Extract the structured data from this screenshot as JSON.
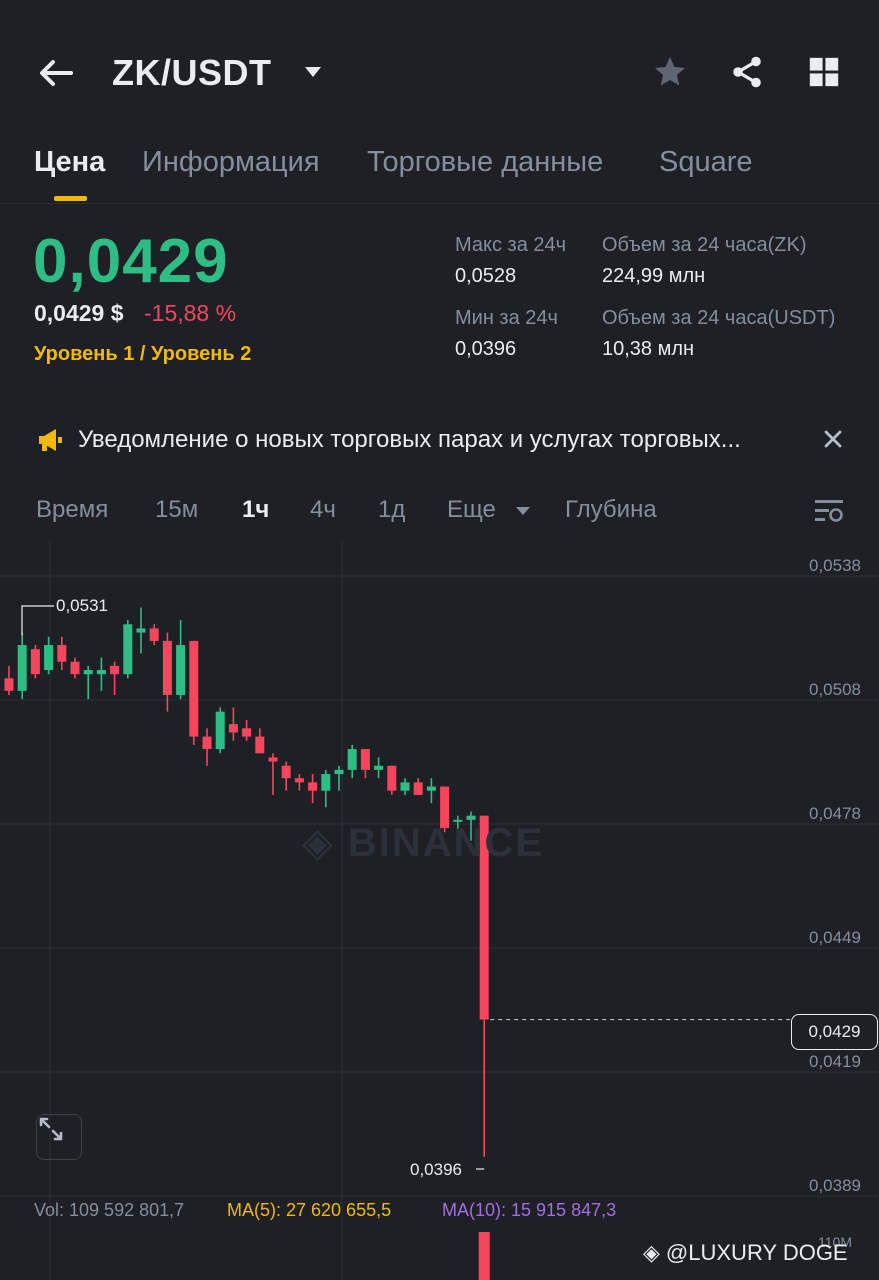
{
  "header": {
    "pair": "ZK/USDT",
    "icons": [
      "back-arrow-icon",
      "caret-down-icon",
      "star-icon",
      "share-icon",
      "grid-icon"
    ]
  },
  "tabs": [
    {
      "label": "Цена",
      "active": true
    },
    {
      "label": "Информация",
      "active": false
    },
    {
      "label": "Торговые данные",
      "active": false
    },
    {
      "label": "Square",
      "active": false
    }
  ],
  "price": {
    "last": "0,0429",
    "usd": "0,0429 $",
    "change": "-15,88 %",
    "level": "Уровень 1 / Уровень 2"
  },
  "stats": {
    "high_label": "Макс за 24ч",
    "high_value": "0,0528",
    "low_label": "Мин за 24ч",
    "low_value": "0,0396",
    "vol_base_label": "Объем за 24 часа(ZK)",
    "vol_base_value": "224,99 млн",
    "vol_quote_label": "Объем за 24 часа(USDT)",
    "vol_quote_value": "10,38 млн"
  },
  "notice": {
    "text": "Уведомление о новых торговых парах и услугах торговых...",
    "icon": "megaphone-icon"
  },
  "intervals": [
    {
      "label": "Время",
      "active": false
    },
    {
      "label": "15м",
      "active": false
    },
    {
      "label": "1ч",
      "active": true
    },
    {
      "label": "4ч",
      "active": false
    },
    {
      "label": "1д",
      "active": false
    },
    {
      "label": "Еще",
      "active": false
    },
    {
      "label": "Глубина",
      "active": false
    }
  ],
  "chart_data": {
    "type": "candlestick",
    "y_ticks": [
      "0,0538",
      "0,0508",
      "0,0478",
      "0,0449",
      "0,0419",
      "0,0389"
    ],
    "ylim": [
      0.0389,
      0.0538
    ],
    "current_price": "0,0429",
    "high_marker": "0,0531",
    "low_marker": "0,0396",
    "watermark": "BINANCE",
    "candles": [
      {
        "o": 0.0511,
        "h": 0.0514,
        "l": 0.0507,
        "c": 0.0508
      },
      {
        "o": 0.0508,
        "h": 0.0522,
        "l": 0.0506,
        "c": 0.0519
      },
      {
        "o": 0.0518,
        "h": 0.0519,
        "l": 0.0511,
        "c": 0.0512
      },
      {
        "o": 0.0513,
        "h": 0.0521,
        "l": 0.0512,
        "c": 0.0519
      },
      {
        "o": 0.0519,
        "h": 0.0521,
        "l": 0.0513,
        "c": 0.0515
      },
      {
        "o": 0.0515,
        "h": 0.0516,
        "l": 0.0511,
        "c": 0.0512
      },
      {
        "o": 0.0512,
        "h": 0.0514,
        "l": 0.0506,
        "c": 0.0513
      },
      {
        "o": 0.0512,
        "h": 0.0516,
        "l": 0.0508,
        "c": 0.0513
      },
      {
        "o": 0.0514,
        "h": 0.0515,
        "l": 0.0507,
        "c": 0.0512
      },
      {
        "o": 0.0512,
        "h": 0.0525,
        "l": 0.0511,
        "c": 0.0524
      },
      {
        "o": 0.0522,
        "h": 0.0528,
        "l": 0.0517,
        "c": 0.0523
      },
      {
        "o": 0.0523,
        "h": 0.0524,
        "l": 0.0519,
        "c": 0.052
      },
      {
        "o": 0.052,
        "h": 0.0522,
        "l": 0.0503,
        "c": 0.0507
      },
      {
        "o": 0.0507,
        "h": 0.0525,
        "l": 0.0506,
        "c": 0.0519
      },
      {
        "o": 0.052,
        "h": 0.052,
        "l": 0.0495,
        "c": 0.0497
      },
      {
        "o": 0.0497,
        "h": 0.0499,
        "l": 0.049,
        "c": 0.0494
      },
      {
        "o": 0.0494,
        "h": 0.0504,
        "l": 0.0493,
        "c": 0.0503
      },
      {
        "o": 0.05,
        "h": 0.0504,
        "l": 0.0496,
        "c": 0.0498
      },
      {
        "o": 0.0499,
        "h": 0.0501,
        "l": 0.0496,
        "c": 0.0497
      },
      {
        "o": 0.0497,
        "h": 0.0499,
        "l": 0.0493,
        "c": 0.0493
      },
      {
        "o": 0.0492,
        "h": 0.0493,
        "l": 0.0483,
        "c": 0.0491
      },
      {
        "o": 0.049,
        "h": 0.0491,
        "l": 0.0484,
        "c": 0.0487
      },
      {
        "o": 0.0487,
        "h": 0.0488,
        "l": 0.0484,
        "c": 0.0486
      },
      {
        "o": 0.0486,
        "h": 0.0488,
        "l": 0.0481,
        "c": 0.0484
      },
      {
        "o": 0.0484,
        "h": 0.0489,
        "l": 0.048,
        "c": 0.0488
      },
      {
        "o": 0.0488,
        "h": 0.049,
        "l": 0.0484,
        "c": 0.0489
      },
      {
        "o": 0.0489,
        "h": 0.0495,
        "l": 0.0487,
        "c": 0.0494
      },
      {
        "o": 0.0494,
        "h": 0.0494,
        "l": 0.0487,
        "c": 0.0489
      },
      {
        "o": 0.0489,
        "h": 0.0492,
        "l": 0.0487,
        "c": 0.049
      },
      {
        "o": 0.049,
        "h": 0.049,
        "l": 0.0483,
        "c": 0.0484
      },
      {
        "o": 0.0484,
        "h": 0.0487,
        "l": 0.0483,
        "c": 0.0486
      },
      {
        "o": 0.0486,
        "h": 0.0487,
        "l": 0.0483,
        "c": 0.0483
      },
      {
        "o": 0.0484,
        "h": 0.0487,
        "l": 0.0481,
        "c": 0.0485
      },
      {
        "o": 0.0485,
        "h": 0.0485,
        "l": 0.0474,
        "c": 0.0475
      },
      {
        "o": 0.0477,
        "h": 0.0478,
        "l": 0.0472,
        "c": 0.0477
      },
      {
        "o": 0.0477,
        "h": 0.0479,
        "l": 0.0472,
        "c": 0.0478
      },
      {
        "o": 0.0478,
        "h": 0.0478,
        "l": 0.0396,
        "c": 0.0429
      }
    ]
  },
  "volume": {
    "vol": "Vol: 109 592 801,7",
    "ma5": "MA(5): 27 620 655,5",
    "ma10": "MA(10): 15 915 847,3",
    "axis_top": "110M"
  },
  "credit": "@LUXURY DOGE",
  "colors": {
    "up": "#2ebd85",
    "down": "#f6465d",
    "accent": "#f0b90b",
    "bg": "#1e2026",
    "ma5": "#f0b90b",
    "ma10": "#a36ee0"
  }
}
